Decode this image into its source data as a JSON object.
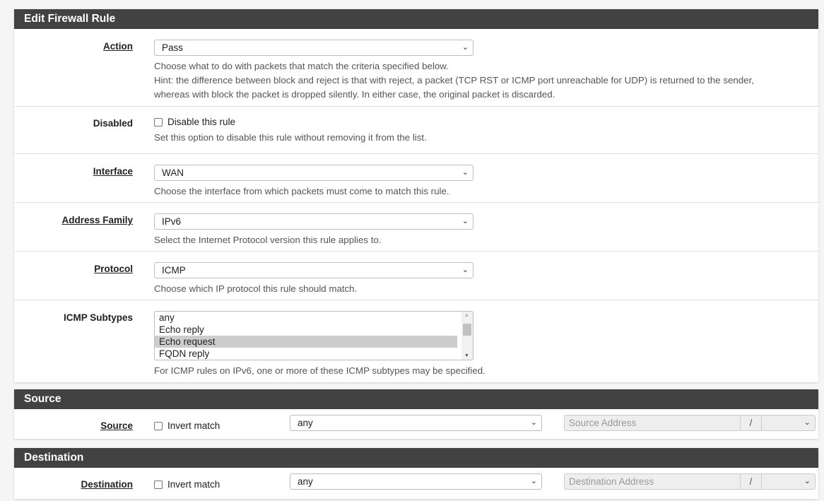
{
  "edit": {
    "title": "Edit Firewall Rule",
    "action": {
      "label": "Action",
      "value": "Pass",
      "help1": "Choose what to do with packets that match the criteria specified below.",
      "help2": "Hint: the difference between block and reject is that with reject, a packet (TCP RST or ICMP port unreachable for UDP) is returned to the sender, whereas with block the packet is dropped silently. In either case, the original packet is discarded."
    },
    "disabled": {
      "label": "Disabled",
      "checkbox": "Disable this rule",
      "checked": false,
      "help": "Set this option to disable this rule without removing it from the list."
    },
    "interface": {
      "label": "Interface",
      "value": "WAN",
      "help": "Choose the interface from which packets must come to match this rule."
    },
    "family": {
      "label": "Address Family",
      "value": "IPv6",
      "help": "Select the Internet Protocol version this rule applies to."
    },
    "protocol": {
      "label": "Protocol",
      "value": "ICMP",
      "help": "Choose which IP protocol this rule should match."
    },
    "icmp": {
      "label": "ICMP Subtypes",
      "options": [
        "any",
        "Echo reply",
        "Echo request",
        "FQDN reply"
      ],
      "selected": "Echo request",
      "help": "For ICMP rules on IPv6, one or more of these ICMP subtypes may be specified."
    }
  },
  "source": {
    "title": "Source",
    "label": "Source",
    "invert": "Invert match",
    "type": "any",
    "address_placeholder": "Source Address",
    "slash": "/"
  },
  "destination": {
    "title": "Destination",
    "label": "Destination",
    "invert": "Invert match",
    "type": "any",
    "address_placeholder": "Destination Address",
    "slash": "/"
  }
}
